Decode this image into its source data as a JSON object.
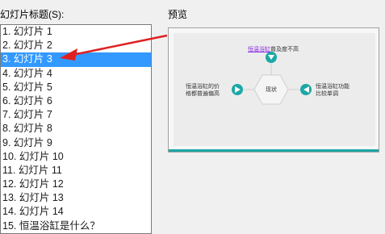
{
  "dialog": {
    "list_label": "幻灯片标题(S):",
    "preview_label": "预览"
  },
  "slides_list": [
    {
      "label": "1. 幻灯片 1",
      "selected": false
    },
    {
      "label": "2. 幻灯片 2",
      "selected": false
    },
    {
      "label": "3. 幻灯片 3",
      "selected": true
    },
    {
      "label": "4. 幻灯片 4",
      "selected": false
    },
    {
      "label": "5. 幻灯片 5",
      "selected": false
    },
    {
      "label": "6. 幻灯片 6",
      "selected": false
    },
    {
      "label": "7. 幻灯片 7",
      "selected": false
    },
    {
      "label": "8. 幻灯片 8",
      "selected": false
    },
    {
      "label": "9. 幻灯片 9",
      "selected": false
    },
    {
      "label": "10. 幻灯片 10",
      "selected": false
    },
    {
      "label": "11. 幻灯片 11",
      "selected": false
    },
    {
      "label": "12. 幻灯片 12",
      "selected": false
    },
    {
      "label": "13. 幻灯片 13",
      "selected": false
    },
    {
      "label": "14. 幻灯片 14",
      "selected": false
    },
    {
      "label": "15. 恒温浴缸是什么？",
      "selected": false
    }
  ],
  "preview": {
    "top_highlight": "恒温浴缸",
    "top_rest": "普及度不高",
    "left_line1": "恒温浴缸的价",
    "left_line2": "格都普遍偏高",
    "center": "现状",
    "right_line1": "恒温浴缸功能",
    "right_line2": "比较单调",
    "accent_color": "#1ca7a7"
  },
  "colors": {
    "selection": "#3399ff",
    "arrow": "#e02020"
  }
}
